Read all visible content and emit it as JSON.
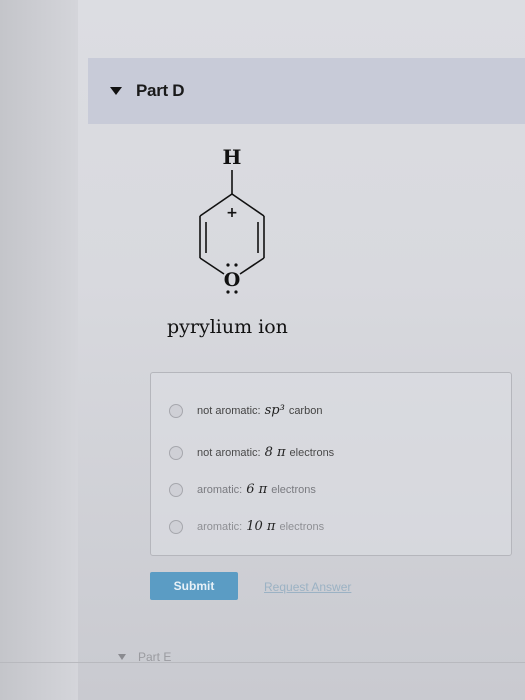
{
  "part_d": {
    "title": "Part D"
  },
  "molecule": {
    "top_atom": "H",
    "charge": "+",
    "hetero_atom": "O",
    "caption": "pyrylium ion"
  },
  "options": [
    {
      "before": "not aromatic:",
      "emph": "sp³",
      "after": "carbon"
    },
    {
      "before": "not aromatic:",
      "emph": "8 π",
      "after": "electrons"
    },
    {
      "before": "aromatic:",
      "emph": "6 π",
      "after": "electrons"
    },
    {
      "before": "aromatic:",
      "emph": "10 π",
      "after": "electrons"
    }
  ],
  "actions": {
    "submit_label": "Submit",
    "request_answer_label": "Request Answer"
  },
  "part_e": {
    "title": "Part E"
  },
  "colors": {
    "header_bg": "#c8cbd8",
    "submit_bg": "#5b9cc4",
    "link": "#9bb2c4"
  }
}
